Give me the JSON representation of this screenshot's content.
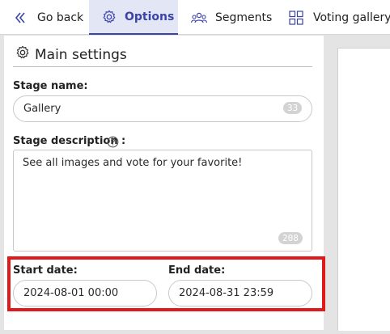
{
  "tabs": {
    "back_label": "Go back",
    "options_label": "Options",
    "segments_label": "Segments",
    "voting_label": "Voting gallery"
  },
  "main": {
    "section_title": "Main settings",
    "stage_name_label": "Stage name:",
    "stage_name_value": "Gallery",
    "stage_name_counter": "33",
    "stage_description_label": "Stage description",
    "stage_description_colon": ":",
    "stage_description_value": "See all images and vote for your favorite!",
    "stage_description_counter": "208",
    "start_date_label": "Start date:",
    "start_date_value": "2024-08-01 00:00",
    "end_date_label": "End date:",
    "end_date_value": "2024-08-31 23:59"
  },
  "colors": {
    "accent": "#3a44a8",
    "active_tab_bg": "#e3e6f4",
    "highlight": "#e01a1a"
  },
  "icons": {
    "back": "chevrons-left-icon",
    "options": "gear-icon",
    "segments": "users-group-icon",
    "voting": "grid-icon",
    "section": "gear-icon",
    "help": "question-circle-icon"
  }
}
